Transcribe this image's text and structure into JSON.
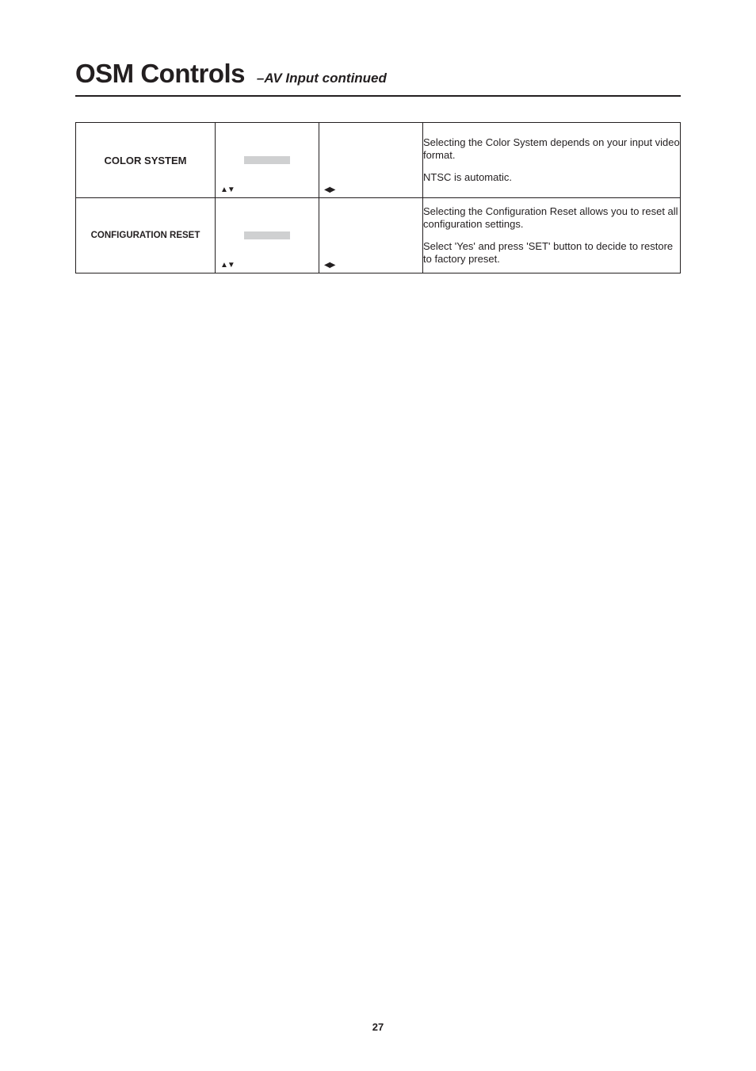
{
  "header": {
    "title_main": "OSM Controls",
    "title_sub": "–AV Input continued"
  },
  "rows": [
    {
      "label": "COLOR SYSTEM",
      "label_small": false,
      "arrows_col2": "▲▼",
      "arrows_col3": "◀▶",
      "desc_p1": "Selecting the Color System depends on your input video format.",
      "desc_p2": "NTSC is automatic."
    },
    {
      "label": "CONFIGURATION RESET",
      "label_small": true,
      "arrows_col2": "▲▼",
      "arrows_col3": "◀▶",
      "desc_p1": "Selecting the Configuration Reset allows you to reset all configuration settings.",
      "desc_p2": "Select 'Yes' and press 'SET' button to decide to restore to factory preset."
    }
  ],
  "page_number": "27"
}
